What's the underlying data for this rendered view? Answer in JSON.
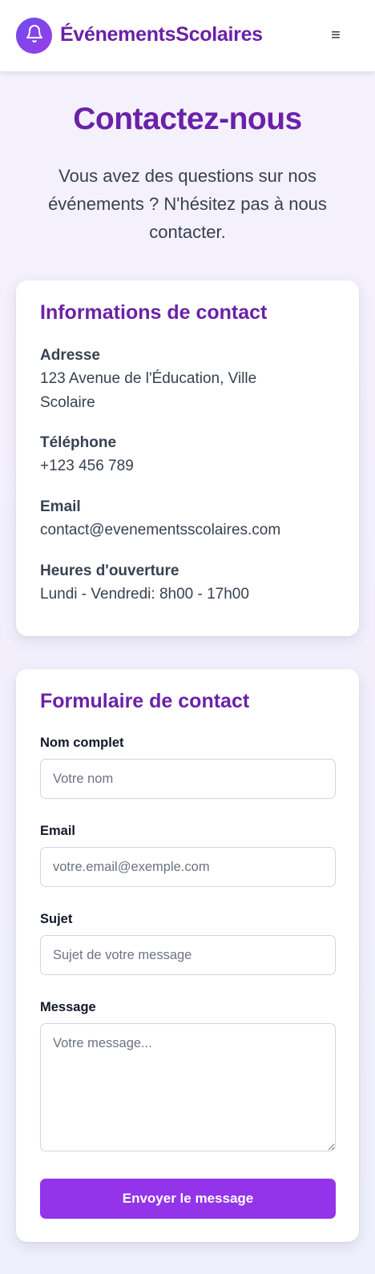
{
  "header": {
    "brand": "ÉvénementsScolaires",
    "menu_icon": "hamburger-menu-icon",
    "menu_glyph": "≡",
    "logo_icon": "bell-icon"
  },
  "page": {
    "title": "Contactez-nous",
    "subtitle": "Vous avez des questions sur nos événements ? N'hésitez pas à nous contacter."
  },
  "contact_info": {
    "title": "Informations de contact",
    "items": [
      {
        "label": "Adresse",
        "value": "123 Avenue de l'Éducation, Ville Scolaire"
      },
      {
        "label": "Téléphone",
        "value": "+123 456 789"
      },
      {
        "label": "Email",
        "value": "contact@evenementsscolaires.com"
      },
      {
        "label": "Heures d'ouverture",
        "value": "Lundi - Vendredi: 8h00 - 17h00"
      }
    ]
  },
  "form": {
    "title": "Formulaire de contact",
    "name": {
      "label": "Nom complet",
      "placeholder": "Votre nom",
      "value": ""
    },
    "email": {
      "label": "Email",
      "placeholder": "votre.email@exemple.com",
      "value": ""
    },
    "subject": {
      "label": "Sujet",
      "placeholder": "Sujet de votre message",
      "value": ""
    },
    "message": {
      "label": "Message",
      "placeholder": "Votre message...",
      "value": ""
    },
    "submit_label": "Envoyer le message"
  },
  "colors": {
    "brand": "#6b21a8",
    "accent_button": "#9333ea",
    "logo_gradient_start": "#6d4cf0",
    "logo_gradient_end": "#9b3ee6"
  }
}
